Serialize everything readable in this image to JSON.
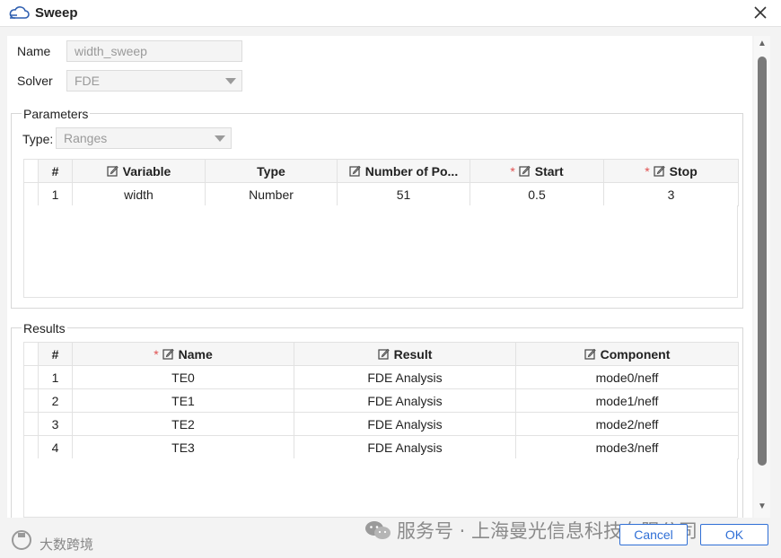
{
  "window": {
    "title": "Sweep"
  },
  "form": {
    "name_label": "Name",
    "name_value": "width_sweep",
    "solver_label": "Solver",
    "solver_value": "FDE"
  },
  "parameters": {
    "group_title": "Parameters",
    "type_label": "Type:",
    "type_value": "Ranges",
    "columns": {
      "index": "#",
      "variable": "Variable",
      "type": "Type",
      "points": "Number of Po...",
      "start": "Start",
      "stop": "Stop"
    },
    "rows": [
      {
        "index": "1",
        "variable": "width",
        "type": "Number",
        "points": "51",
        "start": "0.5",
        "stop": "3"
      }
    ]
  },
  "results": {
    "group_title": "Results",
    "columns": {
      "index": "#",
      "name": "Name",
      "result": "Result",
      "component": "Component"
    },
    "rows": [
      {
        "index": "1",
        "name": "TE0",
        "result": "FDE Analysis",
        "component": "mode0/neff"
      },
      {
        "index": "2",
        "name": "TE1",
        "result": "FDE Analysis",
        "component": "mode1/neff"
      },
      {
        "index": "3",
        "name": "TE2",
        "result": "FDE Analysis",
        "component": "mode2/neff"
      },
      {
        "index": "4",
        "name": "TE3",
        "result": "FDE Analysis",
        "component": "mode3/neff"
      }
    ]
  },
  "footer": {
    "status_text": "大数跨境",
    "watermark_text": "服务号 · 上海曼光信息科技有限公司",
    "cancel_label": "Cancel",
    "ok_label": "OK"
  },
  "icons": {
    "app": "cloud-icon",
    "close": "close-icon",
    "edit": "edit-icon",
    "wechat": "wechat-icon"
  },
  "colors": {
    "accent": "#2f6fd6",
    "required": "#e05050",
    "disabled_text": "#9a9a9a"
  }
}
